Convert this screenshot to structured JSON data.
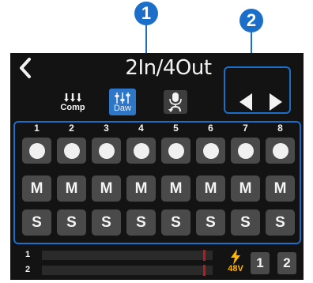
{
  "callouts": [
    "1",
    "2"
  ],
  "header": {
    "title": "2In/4Out"
  },
  "modes": [
    {
      "label": "Comp",
      "icon": "compressor-icon"
    },
    {
      "label": "Daw",
      "icon": "daw-mixer-icon",
      "selected": true
    },
    {
      "label": "",
      "icon": "loopback-mic-icon"
    }
  ],
  "channels": [
    "1",
    "2",
    "3",
    "4",
    "5",
    "6",
    "7",
    "8"
  ],
  "buttons": {
    "mute": "M",
    "solo": "S"
  },
  "meters": [
    {
      "label": "1",
      "level": 0
    },
    {
      "label": "2",
      "level": 0
    }
  ],
  "phantom": {
    "label": "48V",
    "icon": "lightning-icon"
  },
  "inputs": [
    "1",
    "2"
  ],
  "colors": {
    "accent": "#1b6fc9",
    "screen": "#131313",
    "button": "#4a4a4a",
    "peak": "#c21818",
    "phantom": "#ffb400"
  }
}
